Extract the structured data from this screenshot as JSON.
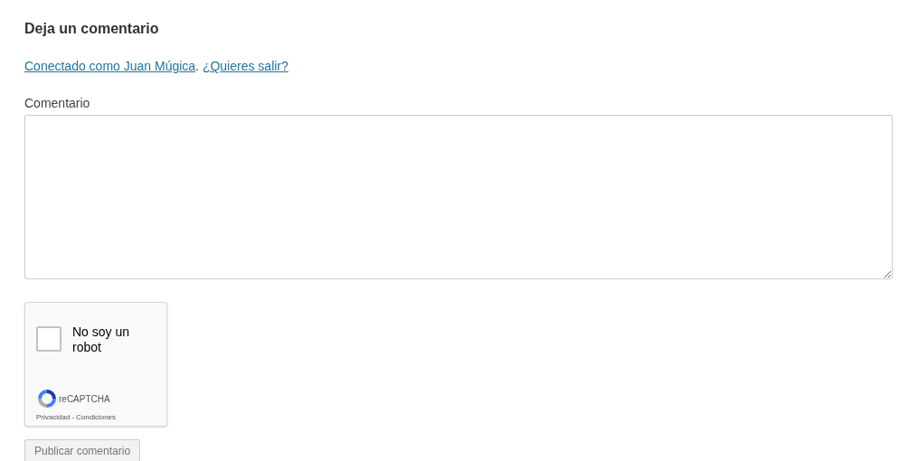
{
  "heading": "Deja un comentario",
  "logged_in": {
    "user_link": "Conectado como Juan Múgica",
    "separator": ".",
    "logout_link": "¿Quieres salir?"
  },
  "comment_field": {
    "label": "Comentario"
  },
  "captcha": {
    "checked": false,
    "label": "No soy un robot",
    "brand": "reCAPTCHA",
    "privacy": "Privacidad",
    "dash": "-",
    "terms": "Condiciones"
  },
  "submit_button": "Publicar comentario"
}
